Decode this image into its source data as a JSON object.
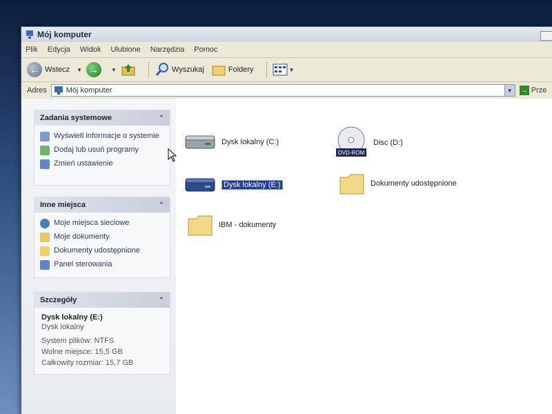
{
  "window": {
    "title": "Mój komputer"
  },
  "menu": [
    "Plik",
    "Edycja",
    "Widok",
    "Ulubione",
    "Narzędzia",
    "Pomoc"
  ],
  "toolbar": {
    "back": "Wstecz",
    "search": "Wyszukaj",
    "folders": "Foldery"
  },
  "address": {
    "label": "Adres",
    "value": "Mój komputer",
    "go": "Prze"
  },
  "tasks": {
    "system": {
      "title": "Zadania systemowe",
      "items": [
        "Wyświetl informacje o systemie",
        "Dodaj lub usuń programy",
        "Zmień ustawienie"
      ]
    },
    "places": {
      "title": "Inne miejsca",
      "items": [
        "Moje miejsca sieciowe",
        "Moje dokumenty",
        "Dokumenty udostępnione",
        "Panel sterowania"
      ]
    },
    "details": {
      "title": "Szczegóły",
      "name": "Dysk lokalny (E:)",
      "type": "Dysk lokalny",
      "fs": "System plików: NTFS",
      "free": "Wolne miejsce: 15,5 GB",
      "total": "Całkowity rozmiar: 15,7 GB"
    }
  },
  "files": {
    "c": "Dysk lokalny (C:)",
    "d": "Disc (D:)",
    "d_badge": "DVD-ROM",
    "e": "Dysk lokalny (E:)",
    "shared": "Dokumenty udostępnione",
    "ibm": "IBM - dokumenty"
  },
  "colors": {
    "selection": "#1f3e9e",
    "panel_header": "#c8cfdb"
  }
}
